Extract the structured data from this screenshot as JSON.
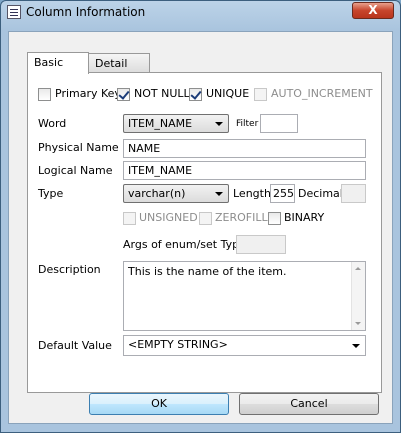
{
  "window": {
    "title": "Column Information",
    "close_label": "X"
  },
  "tabs": [
    {
      "label": "Basic",
      "active": true
    },
    {
      "label": "Detail",
      "active": false
    }
  ],
  "flags": {
    "primary_key": {
      "label": "Primary Key",
      "checked": false,
      "enabled": true
    },
    "not_null": {
      "label": "NOT NULL",
      "checked": true,
      "enabled": true
    },
    "unique": {
      "label": "UNIQUE",
      "checked": true,
      "enabled": true
    },
    "auto_increment": {
      "label": "AUTO_INCREMENT",
      "checked": false,
      "enabled": false
    }
  },
  "word": {
    "label": "Word",
    "value": "ITEM_NAME",
    "filter_label": "Filter",
    "filter_value": ""
  },
  "physical_name": {
    "label": "Physical Name",
    "value": "NAME"
  },
  "logical_name": {
    "label": "Logical Name",
    "value": "ITEM_NAME"
  },
  "type": {
    "label": "Type",
    "value": "varchar(n)",
    "length_label": "Length",
    "length_value": "255",
    "decimal_label": "Decimal",
    "decimal_value": ""
  },
  "type_flags": {
    "unsigned": {
      "label": "UNSIGNED",
      "checked": false,
      "enabled": false
    },
    "zerofill": {
      "label": "ZEROFILL",
      "checked": false,
      "enabled": false
    },
    "binary": {
      "label": "BINARY",
      "checked": false,
      "enabled": true
    }
  },
  "enum_args": {
    "label": "Args of enum/set Type",
    "value": ""
  },
  "description": {
    "label": "Description",
    "value": "This is the name of the item."
  },
  "default_value": {
    "label": "Default Value",
    "value": "<EMPTY STRING>"
  },
  "buttons": {
    "ok": "OK",
    "cancel": "Cancel"
  }
}
